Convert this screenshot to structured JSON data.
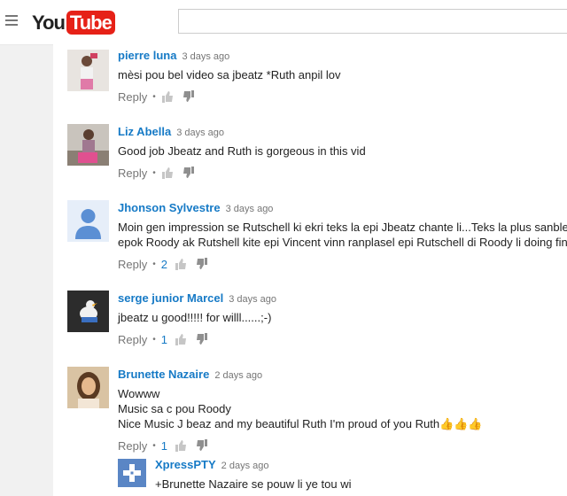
{
  "header": {
    "logo_you": "You",
    "logo_tube": "Tube",
    "search_value": ""
  },
  "colors": {
    "link": "#167ac6",
    "brand": "#e62117"
  },
  "comments": [
    {
      "author": "pierre luna",
      "time": "3 days ago",
      "text": "mèsi pou bel video sa jbeatz *Ruth anpil lov",
      "reply": "Reply",
      "likes": ""
    },
    {
      "author": "Liz Abella",
      "time": "3 days ago",
      "text": "Good job Jbeatz and Ruth is gorgeous in this vid",
      "reply": "Reply",
      "likes": ""
    },
    {
      "author": "Jhonson Sylvestre",
      "time": "3 days ago",
      "text_line1": "Moin gen impression se Rutschell ki ekri teks la epi Jbeatz chante li...Teks la plus sanble",
      "text_line2": "epok Roody ak Rutshell kite epi Vincent vinn ranplasel epi Rutschell di Roody li doing fine",
      "reply": "Reply",
      "likes": "2"
    },
    {
      "author": "serge junior Marcel",
      "time": "3 days ago",
      "text": "jbeatz u good!!!!! for willl......;-)",
      "reply": "Reply",
      "likes": "1"
    },
    {
      "author": "Brunette Nazaire",
      "time": "2 days ago",
      "text_line1": "Wowww",
      "text_line2": "Music sa c pou Roody",
      "text_line3": "Nice Music J beaz and my beautiful Ruth I'm proud of you Ruth",
      "emoji": "👍👍👍",
      "reply": "Reply",
      "likes": "1"
    }
  ],
  "sub_reply": {
    "author": "XpressPTY",
    "time": "2 days ago",
    "text": "+Brunette Nazaire  se pouw li ye tou wi"
  }
}
